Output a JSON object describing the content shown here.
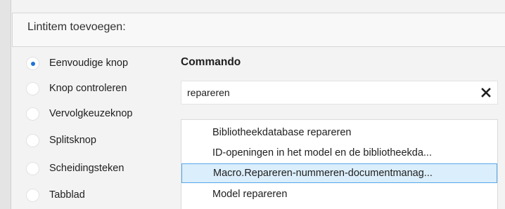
{
  "header": {
    "title": "Lintitem toevoegen:"
  },
  "item_types": {
    "options": [
      {
        "label": "Eenvoudige knop",
        "checked": true
      },
      {
        "label": "Knop controleren",
        "checked": false
      },
      {
        "label": "Vervolgkeuzeknop",
        "checked": false
      },
      {
        "label": "Splitsknop",
        "checked": false
      },
      {
        "label": "Scheidingsteken",
        "checked": false
      },
      {
        "label": "Tabblad",
        "checked": false
      }
    ]
  },
  "command": {
    "title": "Commando",
    "search_value": "repareren",
    "clear_icon": "close-icon",
    "results": [
      {
        "label": "Bibliotheekdatabase repareren",
        "selected": false
      },
      {
        "label": "ID-openingen in het model en de bibliotheekda...",
        "selected": false
      },
      {
        "label": "Macro.Repareren-nummeren-documentmanag...",
        "selected": true
      },
      {
        "label": "Model repareren",
        "selected": false
      }
    ]
  },
  "colors": {
    "accent": "#1f73d6",
    "selection_fill": "#dbeefb",
    "selection_border": "#56a7e8"
  }
}
